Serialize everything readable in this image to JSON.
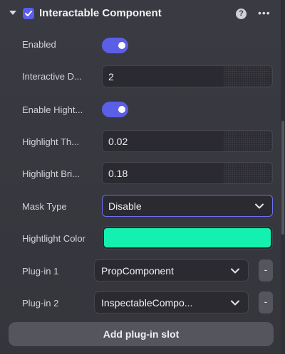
{
  "component": {
    "title": "Interactable Component",
    "enabled_checkbox": true,
    "help_icon": "question-circle-icon",
    "help_glyph": "?",
    "more_icon": "more-horizontal-icon",
    "more_glyph": "•••"
  },
  "properties": [
    {
      "label": "Enabled",
      "kind": "toggle",
      "value": true
    },
    {
      "label": "Interactive D...",
      "kind": "number",
      "value": "2"
    },
    {
      "label": "Enable Hight...",
      "kind": "toggle",
      "value": true
    },
    {
      "label": "Highlight Th...",
      "kind": "number",
      "value": "0.02"
    },
    {
      "label": "Highlight Bri...",
      "kind": "number",
      "value": "0.18"
    },
    {
      "label": "Mask Type",
      "kind": "select",
      "value": "Disable"
    },
    {
      "label": "Hightlight Color",
      "kind": "color",
      "value": "#13f0b0"
    }
  ],
  "plugins": [
    {
      "label": "Plug-in 1",
      "value": "PropComponent",
      "remove": "-"
    },
    {
      "label": "Plug-in 2",
      "value": "InspectableCompo...",
      "remove": "-"
    }
  ],
  "add_button": "Add plug-in slot",
  "colors": {
    "accent": "#5b5fe8",
    "highlight_color": "#13f0b0",
    "panel_bg": "#38383f"
  }
}
